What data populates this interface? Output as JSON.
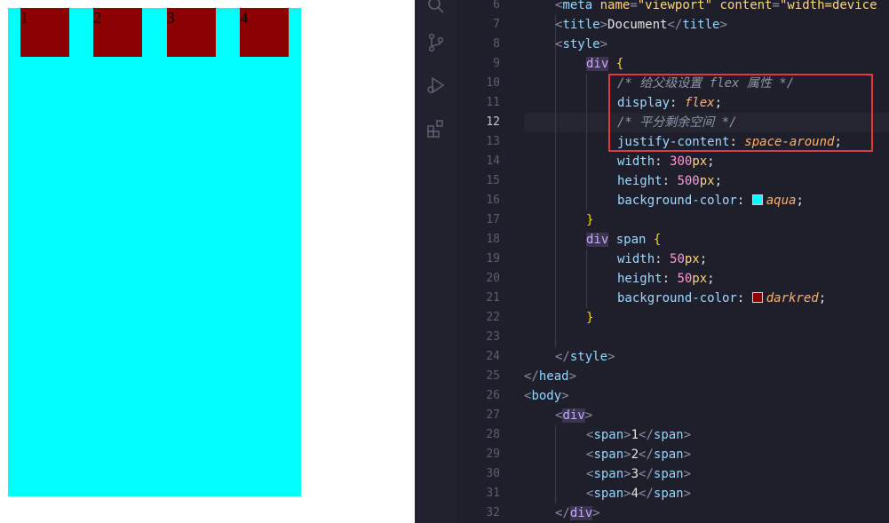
{
  "preview": {
    "boxes": [
      "1",
      "2",
      "3",
      "4"
    ],
    "container_color": "#00ffff",
    "box_color": "#8b0000"
  },
  "editor": {
    "activity_icons": [
      "search-icon",
      "source-control-icon",
      "run-debug-icon",
      "extensions-icon"
    ],
    "line_numbers": [
      "6",
      "7",
      "8",
      "9",
      "10",
      "11",
      "12",
      "13",
      "14",
      "15",
      "16",
      "17",
      "18",
      "19",
      "20",
      "21",
      "22",
      "23",
      "24",
      "25",
      "26",
      "27",
      "28",
      "29",
      "30",
      "31",
      "32"
    ],
    "active_line": "12",
    "highlight_color": "#e0393e",
    "lines": {
      "l6": {
        "tag": "meta",
        "attr1": "name",
        "val1": "\"viewport\"",
        "attr2": "content",
        "val2": "\"width=device"
      },
      "l7": {
        "tag": "title",
        "text": "Document",
        "close": "title"
      },
      "l8": {
        "tag": "style"
      },
      "l9": {
        "selector": "div",
        "brace": "{"
      },
      "l10": {
        "comment": "/* 给父级设置 flex 属性 */"
      },
      "l11": {
        "prop": "display",
        "value": "flex"
      },
      "l12": {
        "comment": "/* 平分剩余空间 */"
      },
      "l13": {
        "prop": "justify-content",
        "value": "space-around"
      },
      "l14": {
        "prop": "width",
        "num": "300",
        "unit": "px"
      },
      "l15": {
        "prop": "height",
        "num": "500",
        "unit": "px"
      },
      "l16": {
        "prop": "background-color",
        "value": "aqua",
        "swatch": "#00ffff"
      },
      "l17": {
        "brace": "}"
      },
      "l18": {
        "selector": "div",
        "selector2": "span",
        "brace": "{"
      },
      "l19": {
        "prop": "width",
        "num": "50",
        "unit": "px"
      },
      "l20": {
        "prop": "height",
        "num": "50",
        "unit": "px"
      },
      "l21": {
        "prop": "background-color",
        "value": "darkred",
        "swatch": "#8b0000"
      },
      "l22": {
        "brace": "}"
      },
      "l24": {
        "close": "style"
      },
      "l25": {
        "close": "head"
      },
      "l26": {
        "tag": "body"
      },
      "l27": {
        "tag": "div"
      },
      "l28": {
        "tag": "span",
        "text": "1",
        "close": "span"
      },
      "l29": {
        "tag": "span",
        "text": "2",
        "close": "span"
      },
      "l30": {
        "tag": "span",
        "text": "3",
        "close": "span"
      },
      "l31": {
        "tag": "span",
        "text": "4",
        "close": "span"
      },
      "l32": {
        "close": "div"
      }
    }
  }
}
